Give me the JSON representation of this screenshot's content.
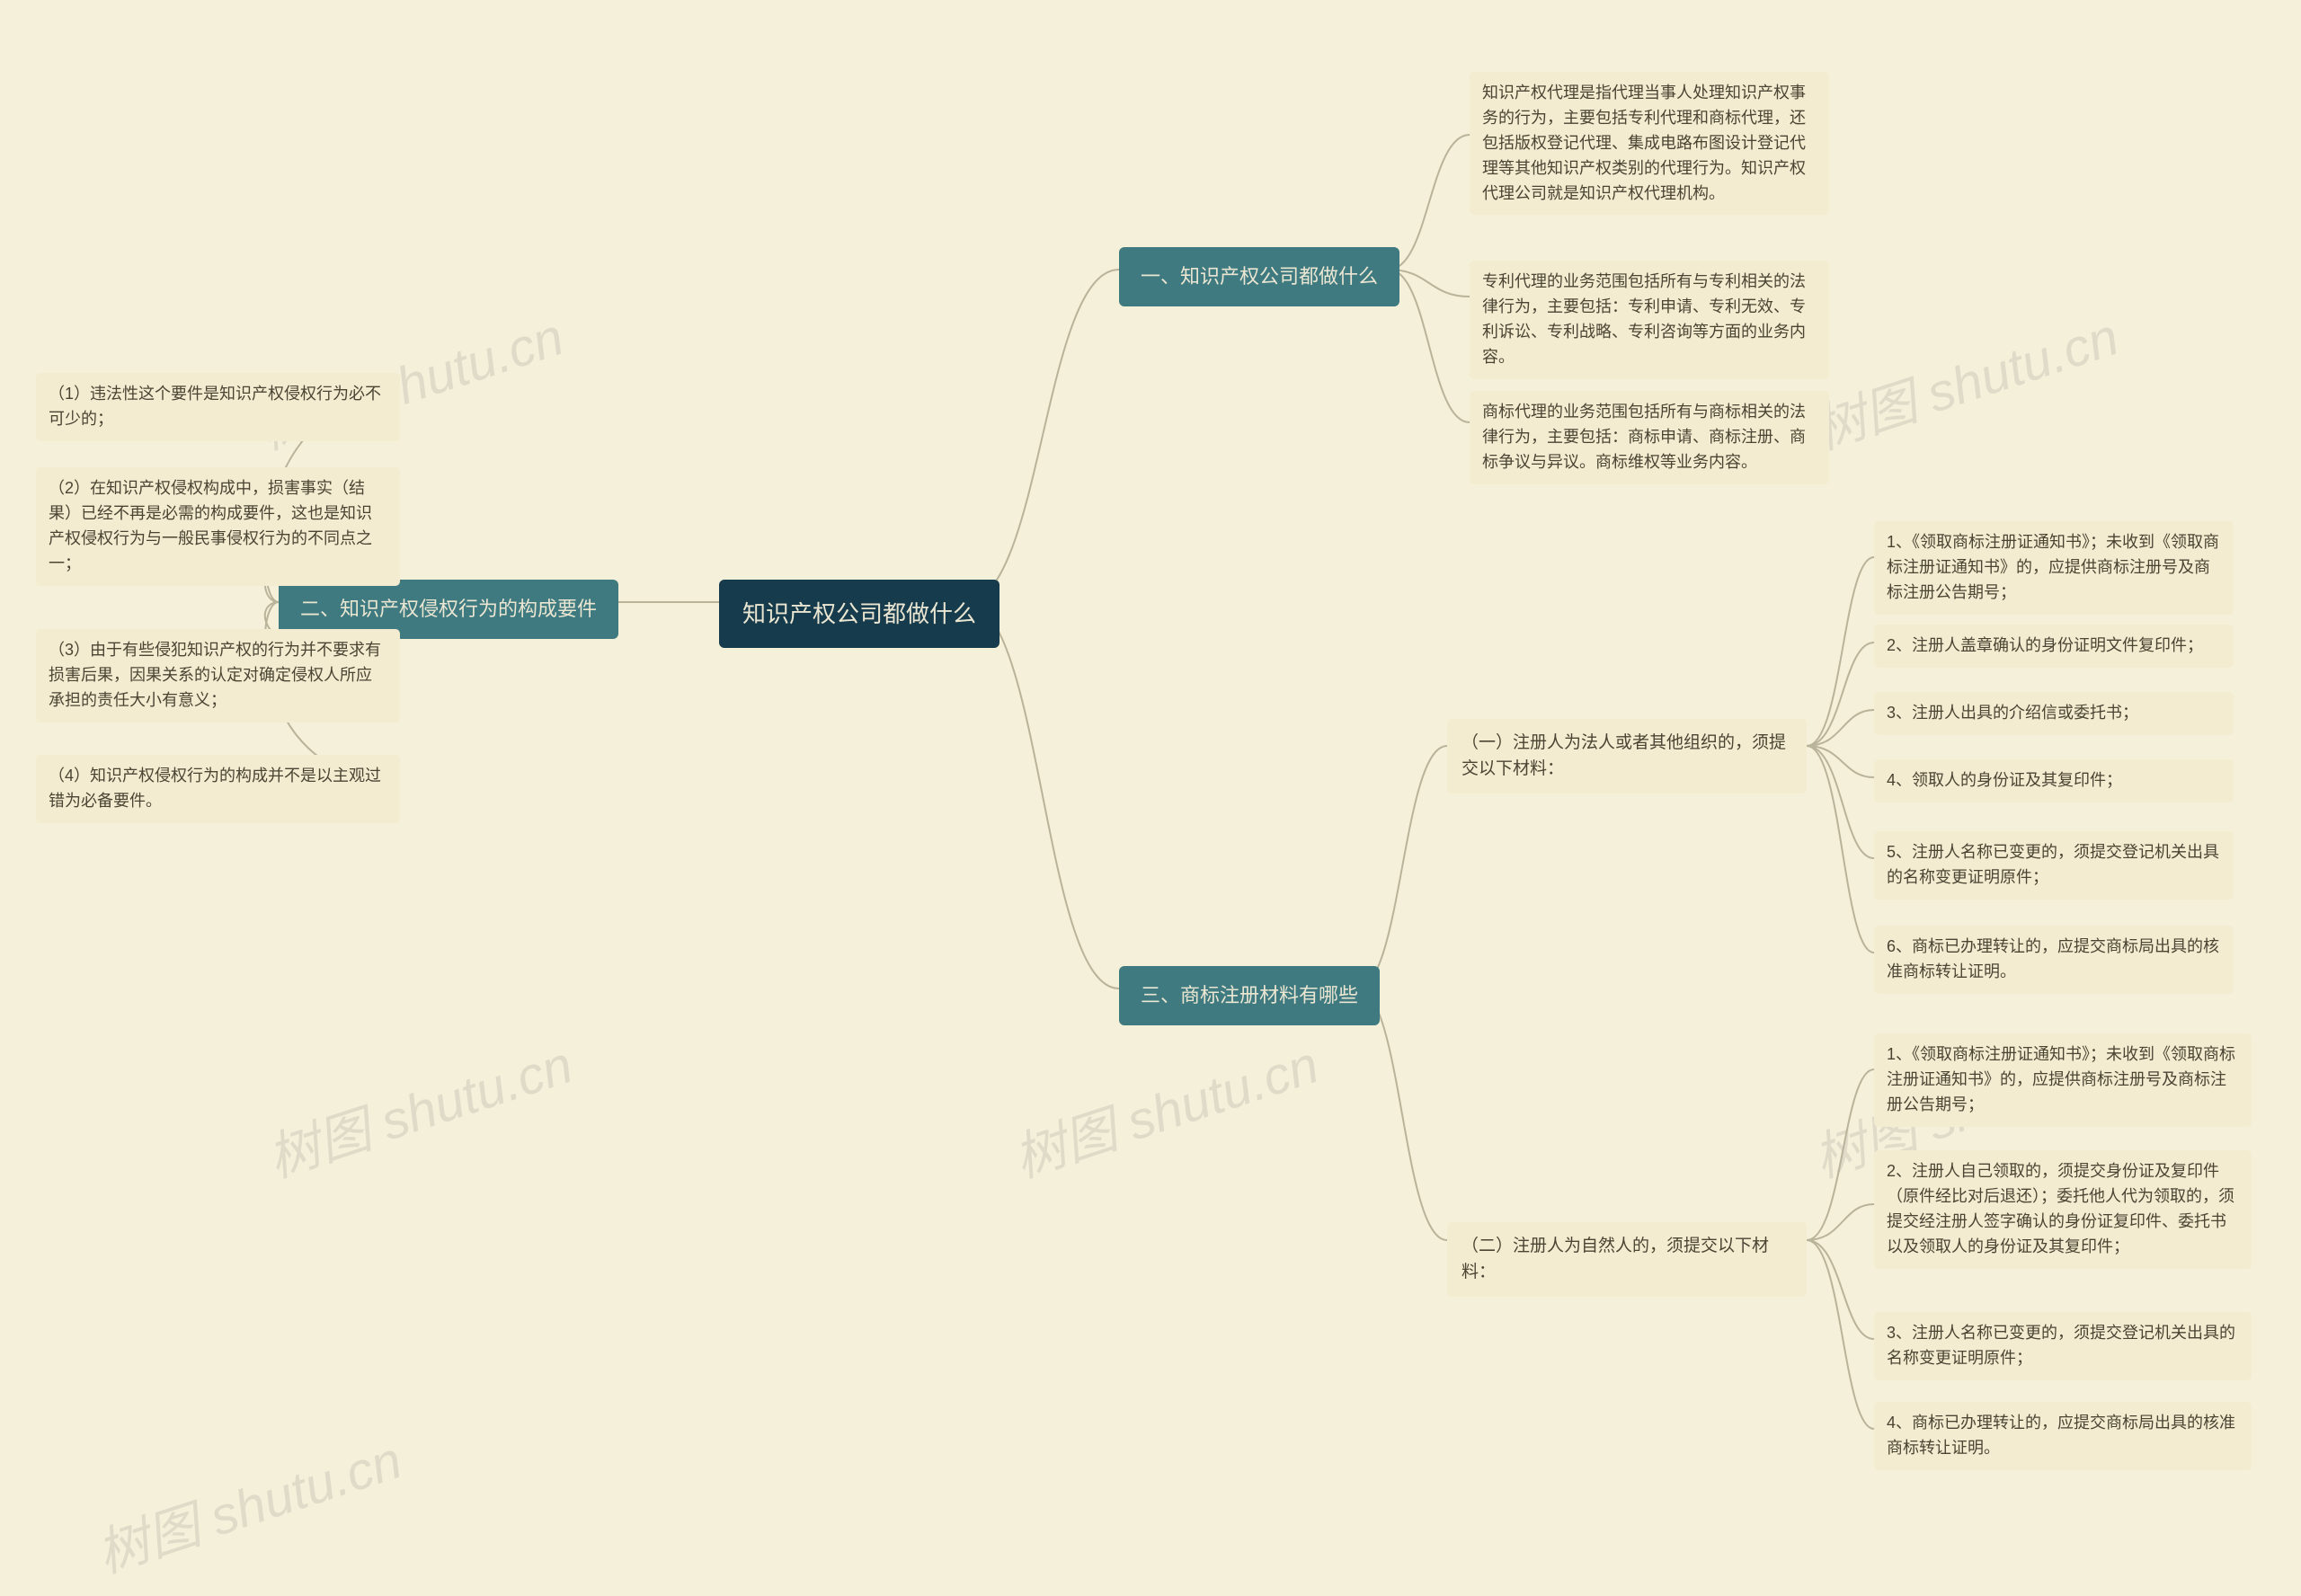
{
  "root": {
    "label": "知识产权公司都做什么"
  },
  "branch1": {
    "label": "一、知识产权公司都做什么",
    "children": [
      "知识产权代理是指代理当事人处理知识产权事务的行为，主要包括专利代理和商标代理，还包括版权登记代理、集成电路布图设计登记代理等其他知识产权类别的代理行为。知识产权代理公司就是知识产权代理机构。",
      "专利代理的业务范围包括所有与专利相关的法律行为，主要包括：专利申请、专利无效、专利诉讼、专利战略、专利咨询等方面的业务内容。",
      "商标代理的业务范围包括所有与商标相关的法律行为，主要包括：商标申请、商标注册、商标争议与异议。商标维权等业务内容。"
    ]
  },
  "branch2": {
    "label": "二、知识产权侵权行为的构成要件",
    "children": [
      "（1）违法性这个要件是知识产权侵权行为必不可少的；",
      "（2）在知识产权侵权构成中，损害事实（结果）已经不再是必需的构成要件，这也是知识产权侵权行为与一般民事侵权行为的不同点之一；",
      "（3）由于有些侵犯知识产权的行为并不要求有损害后果，因果关系的认定对确定侵权人所应承担的责任大小有意义；",
      "（4）知识产权侵权行为的构成并不是以主观过错为必备要件。"
    ]
  },
  "branch3": {
    "label": "三、商标注册材料有哪些",
    "sub1": {
      "label": "（一）注册人为法人或者其他组织的，须提交以下材料：",
      "children": [
        "1、《领取商标注册证通知书》；未收到《领取商标注册证通知书》的，应提供商标注册号及商标注册公告期号；",
        "2、注册人盖章确认的身份证明文件复印件；",
        "3、注册人出具的介绍信或委托书；",
        "4、领取人的身份证及其复印件；",
        "5、注册人名称已变更的，须提交登记机关出具的名称变更证明原件；",
        "6、商标已办理转让的，应提交商标局出具的核准商标转让证明。"
      ]
    },
    "sub2": {
      "label": "（二）注册人为自然人的，须提交以下材料：",
      "children": [
        "1、《领取商标注册证通知书》；未收到《领取商标注册证通知书》的，应提供商标注册号及商标注册公告期号；",
        "2、注册人自己领取的，须提交身份证及复印件（原件经比对后退还）；委托他人代为领取的，须提交经注册人签字确认的身份证复印件、委托书以及领取人的身份证及其复印件；",
        "3、注册人名称已变更的，须提交登记机关出具的名称变更证明原件；",
        "4、商标已办理转让的，应提交商标局出具的核准商标转让证明。"
      ]
    }
  },
  "watermark": "树图 shutu.cn"
}
